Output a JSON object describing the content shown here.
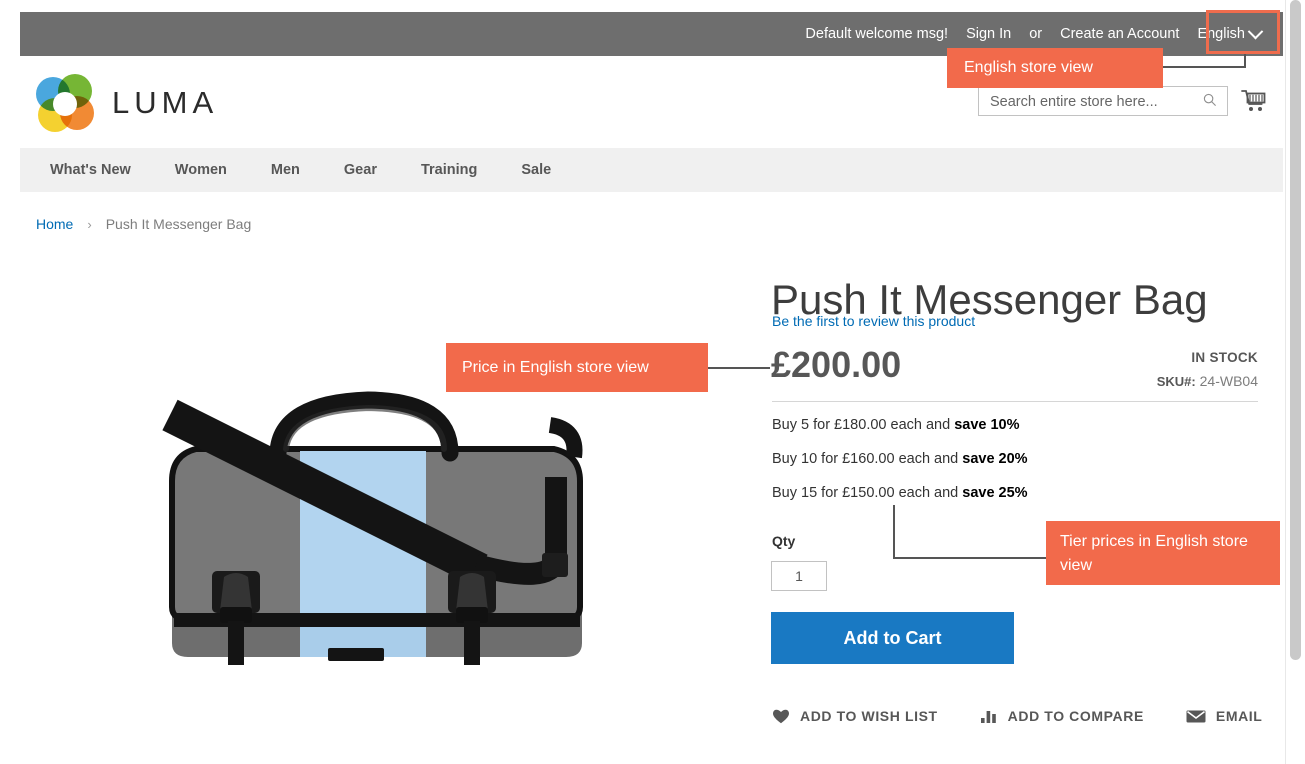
{
  "topbar": {
    "welcome_msg": "Default welcome msg!",
    "sign_in": "Sign In",
    "or": "or",
    "create_account": "Create an Account",
    "language": "English"
  },
  "header": {
    "logo_text": "LUMA",
    "search_placeholder": "Search entire store here...",
    "search_value": "",
    "search_icon": "search-icon",
    "cart_icon": "shopping-cart-icon"
  },
  "nav": {
    "items": [
      {
        "label": "What's New"
      },
      {
        "label": "Women"
      },
      {
        "label": "Men"
      },
      {
        "label": "Gear"
      },
      {
        "label": "Training"
      },
      {
        "label": "Sale"
      }
    ]
  },
  "breadcrumb": {
    "home": "Home",
    "separator": "›",
    "current": "Push It Messenger Bag"
  },
  "product": {
    "title": "Push It Messenger Bag",
    "review_link": "Be the first to review this product",
    "price": "£200.00",
    "stock_status": "IN STOCK",
    "sku_label": "SKU#:",
    "sku_value": "24-WB04",
    "tier_prices": [
      {
        "prefix": "Buy 5 for £180.00 each and ",
        "save": "save 10%"
      },
      {
        "prefix": "Buy 10 for £160.00 each and ",
        "save": "save 20%"
      },
      {
        "prefix": "Buy 15 for £150.00 each and ",
        "save": "save 25%"
      }
    ],
    "qty_label": "Qty",
    "qty_value": "1",
    "add_to_cart": "Add to Cart",
    "actions": [
      {
        "label": "ADD TO WISH LIST",
        "icon": "heart-icon"
      },
      {
        "label": "ADD TO COMPARE",
        "icon": "compare-bars-icon"
      },
      {
        "label": "EMAIL",
        "icon": "envelope-icon"
      }
    ],
    "image_alt": "Push It Messenger Bag grey and light blue messenger bag"
  },
  "annotations": {
    "lang": "English store view",
    "price": "Price in English store view",
    "tier": "Tier prices in English store view",
    "color": "#f26a4b",
    "highlight_color": "#ef6c4d"
  }
}
